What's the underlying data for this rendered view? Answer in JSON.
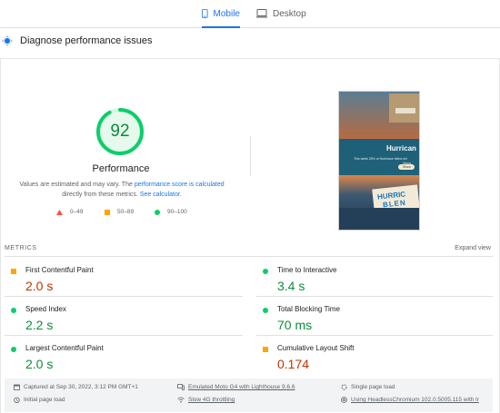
{
  "tabs": {
    "mobile": "Mobile",
    "desktop": "Desktop"
  },
  "diagnose": {
    "title": "Diagnose performance issues"
  },
  "summary": {
    "score": "92",
    "label": "Performance",
    "note_prefix": "Values are estimated and may vary. The ",
    "note_link1": "performance score is calculated",
    "note_mid": "directly from these metrics. ",
    "note_link2": "See calculator."
  },
  "legend": {
    "poor": "0–49",
    "avg": "50–89",
    "good": "90–100"
  },
  "screenshot": {
    "headline": "Hurrican",
    "sub1": "This week 25% of Hurricane blend wh",
    "sub2": "Dispa",
    "cta": "Show",
    "pack1": "HURRIC",
    "pack2": "BLEN"
  },
  "metrics": {
    "header": "METRICS",
    "expand": "Expand view",
    "fcp": {
      "name": "First Contentful Paint",
      "value": "2.0 s"
    },
    "tti": {
      "name": "Time to Interactive",
      "value": "3.4 s"
    },
    "si": {
      "name": "Speed Index",
      "value": "2.2 s"
    },
    "tbt": {
      "name": "Total Blocking Time",
      "value": "70 ms"
    },
    "lcp": {
      "name": "Largest Contentful Paint",
      "value": "2.0 s"
    },
    "cls": {
      "name": "Cumulative Layout Shift",
      "value": "0.174"
    }
  },
  "footer": {
    "captured": "Captured at Sep 30, 2022, 3:12 PM GMT+1",
    "device": "Emulated Moto G4 with Lighthouse 9.6.6",
    "single": "Single page load",
    "initial": "Initial page load",
    "throttle": "Slow 4G throttling",
    "browser": "Using HeadlessChromium 102.0.5005.115 with lr"
  },
  "colors": {
    "accent": "#1a73e8",
    "good": "#0cce6b",
    "average": "#ffa400",
    "poor": "#ff4e42"
  }
}
